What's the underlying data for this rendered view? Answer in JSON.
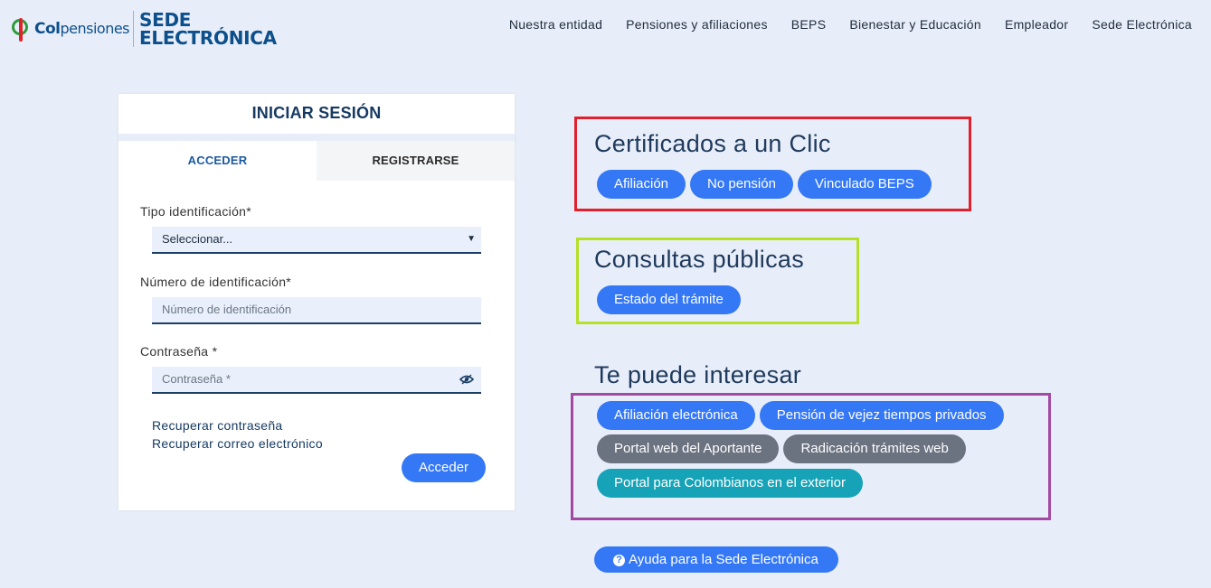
{
  "header": {
    "logo_text_bold": "Col",
    "logo_text_thin": "pensiones",
    "sede_line1": "SEDE",
    "sede_line2": "ELECTRÓNICA",
    "nav": [
      "Nuestra entidad",
      "Pensiones y afiliaciones",
      "BEPS",
      "Bienestar y Educación",
      "Empleador",
      "Sede Electrónica"
    ]
  },
  "login": {
    "title": "INICIAR SESIÓN",
    "tabs": [
      "ACCEDER",
      "REGISTRARSE"
    ],
    "tipo_label": "Tipo identificación*",
    "tipo_value": "Seleccionar...",
    "numero_label": "Número de identificación*",
    "numero_placeholder": "Número de identificación",
    "password_label": "Contraseña *",
    "password_placeholder": "Contraseña *",
    "recover_password": "Recuperar contraseña",
    "recover_email": "Recuperar correo electrónico",
    "submit": "Acceder"
  },
  "certificados": {
    "title": "Certificados a un Clic",
    "buttons": [
      "Afiliación",
      "No pensión",
      "Vinculado BEPS"
    ]
  },
  "consultas": {
    "title": "Consultas públicas",
    "buttons": [
      "Estado del trámite"
    ]
  },
  "interesar": {
    "title": "Te puede interesar",
    "row1": [
      "Afiliación electrónica",
      "Pensión de vejez tiempos privados"
    ],
    "row2": [
      "Portal web del Aportante",
      "Radicación trámites web"
    ],
    "row3": [
      "Portal para Colombianos en el exterior"
    ]
  },
  "help": {
    "label": "Ayuda para la Sede Electrónica"
  },
  "colors": {
    "background": "#e8eef9",
    "primary_button": "#3478f6",
    "gray_button": "#6b7280",
    "teal_button": "#16a3b8",
    "box_certificados": "#e0202c",
    "box_consultas": "#b6e026",
    "box_interesar": "#a349a4"
  }
}
